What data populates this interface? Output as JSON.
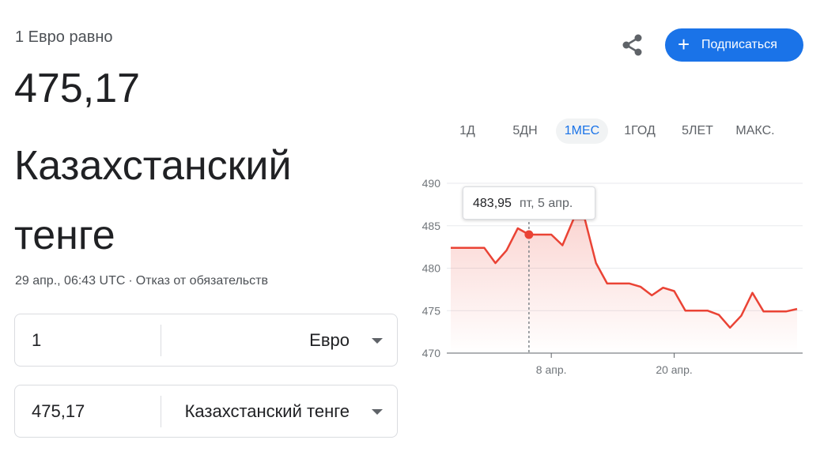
{
  "converter_title": {
    "equals_label": "1 Евро равно",
    "value": "475,17",
    "currency": "Казахстанский тенге"
  },
  "meta": {
    "timestamp": "29 апр., 06:43 UTC",
    "separator": "·",
    "disclaimer": "Отказ от обязательств"
  },
  "from": {
    "amount": "1",
    "currency": "Евро"
  },
  "to": {
    "amount": "475,17",
    "currency": "Казахстанский тенге"
  },
  "actions": {
    "subscribe_label": "Подписаться",
    "share_icon": "share-icon",
    "plus_icon": "plus-icon"
  },
  "range_tabs": [
    "1Д",
    "5ДН",
    "1МЕС",
    "1ГОД",
    "5ЛЕТ",
    "МАКС."
  ],
  "active_range": "1МЕС",
  "colors": {
    "accent": "#1a73e8",
    "line": "#ea4335"
  },
  "tooltip": {
    "value": "483,95",
    "date": "пт, 5 апр."
  },
  "chart_data": {
    "type": "line",
    "y_ticks": [
      490,
      485,
      480,
      475,
      470
    ],
    "ylim": [
      470,
      490
    ],
    "x_ticks": [
      {
        "label": "8 апр.",
        "index": 9
      },
      {
        "label": "20 апр.",
        "index": 20
      }
    ],
    "highlight_index": 7,
    "grid": true,
    "series": [
      {
        "values": [
          482.4,
          482.4,
          482.4,
          482.4,
          480.6,
          482.1,
          484.7,
          483.95,
          483.95,
          483.95,
          482.7,
          485.8,
          485.8,
          480.6,
          478.2,
          478.2,
          478.2,
          477.8,
          476.8,
          477.7,
          477.3,
          475.0,
          475.0,
          475.0,
          474.5,
          473.0,
          474.4,
          477.1,
          474.9,
          474.9,
          474.9,
          475.2
        ]
      }
    ]
  }
}
